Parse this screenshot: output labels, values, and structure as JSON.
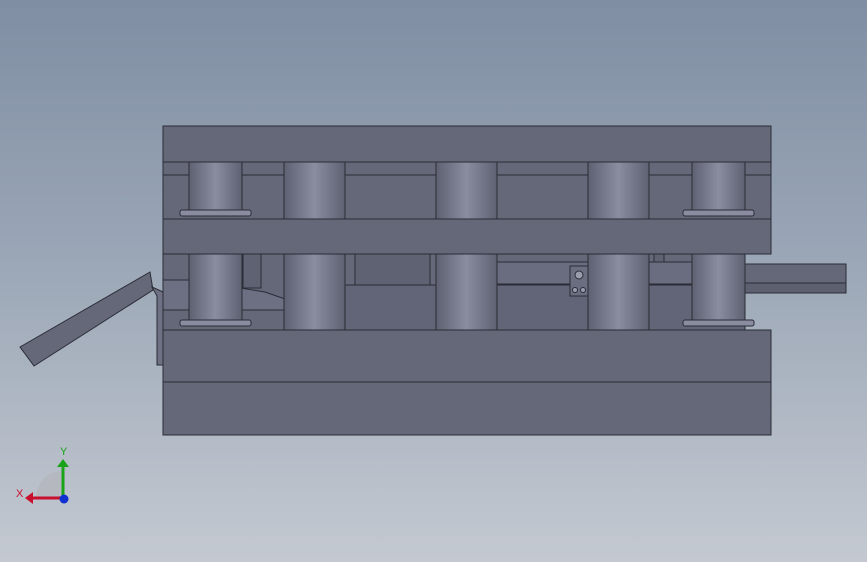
{
  "viewport": {
    "background_top": "#7f8ea3",
    "background_bottom": "#c4c9d1",
    "model_color": "#656879",
    "model_edge": "#2a2c36"
  },
  "triad": {
    "x_label": "X",
    "y_label": "Y",
    "x_color": "#c8102e",
    "y_color": "#1aa31a",
    "z_color": "#1030d0"
  }
}
